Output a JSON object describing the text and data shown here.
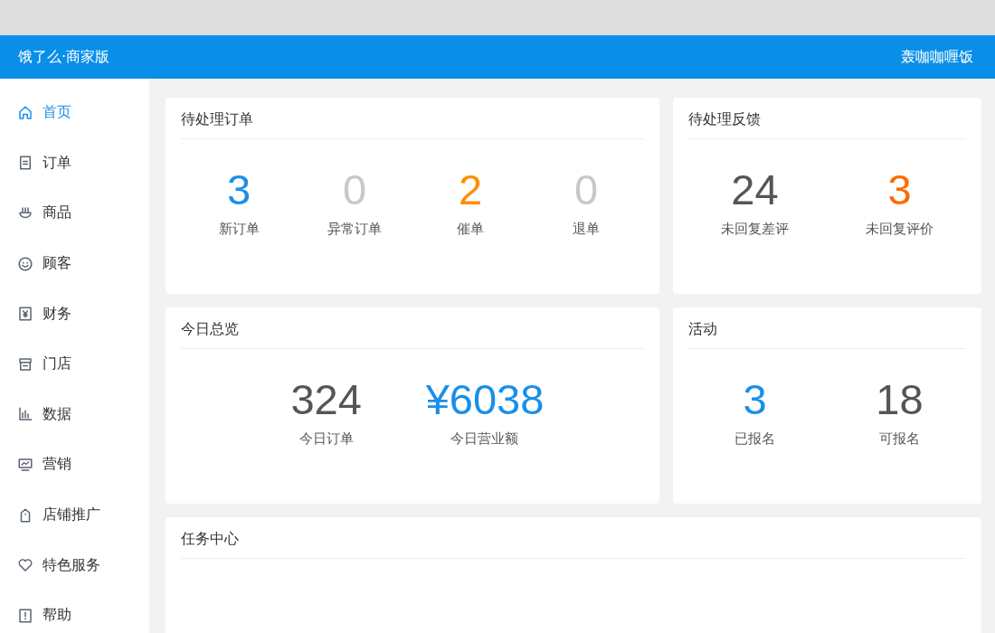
{
  "header": {
    "app_name": "饿了么·商家版",
    "shop_name": "轰咖咖喱饭"
  },
  "sidebar": {
    "items": [
      {
        "label": "首页",
        "selected": true
      },
      {
        "label": "订单",
        "selected": false
      },
      {
        "label": "商品",
        "selected": false
      },
      {
        "label": "顾客",
        "selected": false
      },
      {
        "label": "财务",
        "selected": false
      },
      {
        "label": "门店",
        "selected": false
      },
      {
        "label": "数据",
        "selected": false
      },
      {
        "label": "营销",
        "selected": false
      },
      {
        "label": "店铺推广",
        "selected": false
      },
      {
        "label": "特色服务",
        "selected": false
      },
      {
        "label": "帮助",
        "selected": false
      }
    ]
  },
  "cards": [
    {
      "title": "待处理订单",
      "stats": [
        {
          "value": "3",
          "label": "新订单",
          "color": "#1a8fe8"
        },
        {
          "value": "0",
          "label": "异常订单",
          "color": "#c8c8c8"
        },
        {
          "value": "2",
          "label": "催单",
          "color": "#ff8c00"
        },
        {
          "value": "0",
          "label": "退单",
          "color": "#c8c8c8"
        }
      ]
    },
    {
      "title": "待处理反馈",
      "stats": [
        {
          "value": "24",
          "label": "未回复差评",
          "color": "#555555"
        },
        {
          "value": "3",
          "label": "未回复评价",
          "color": "#ff6a00"
        }
      ]
    },
    {
      "title": "今日总览",
      "stats": [
        {
          "value": "324",
          "label": "今日订单",
          "color": "#555555"
        },
        {
          "value": "¥6038",
          "label": "今日营业额",
          "color": "#1a8fe8"
        }
      ]
    },
    {
      "title": "活动",
      "stats": [
        {
          "value": "3",
          "label": "已报名",
          "color": "#1a8fe8"
        },
        {
          "value": "18",
          "label": "可报名",
          "color": "#555555"
        }
      ]
    }
  ],
  "task_center": {
    "title": "任务中心"
  }
}
